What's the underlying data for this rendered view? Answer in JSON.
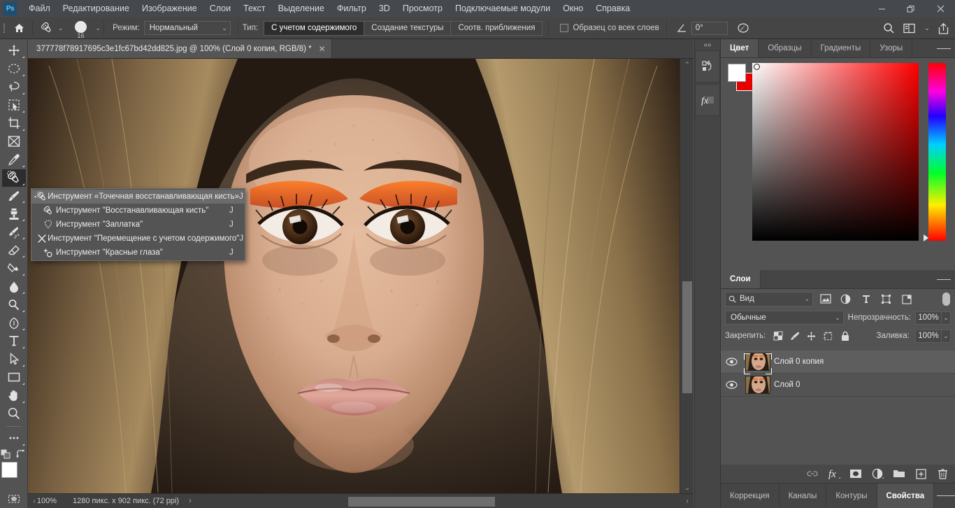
{
  "app": {
    "logo": "Ps",
    "menus": [
      "Файл",
      "Редактирование",
      "Изображение",
      "Слои",
      "Текст",
      "Выделение",
      "Фильтр",
      "3D",
      "Просмотр",
      "Подключаемые модули",
      "Окно",
      "Справка"
    ],
    "window_buttons": {
      "minimize": "—",
      "maximize": "❐",
      "close": "✕"
    }
  },
  "options_bar": {
    "home_icon": "home-icon",
    "brush_preset_icon": "spot-healing-brush-icon",
    "brush_size": "16",
    "mode_label": "Режим:",
    "mode_value": "Нормальный",
    "type_label": "Тип:",
    "type_options": [
      "С учетом содержимого",
      "Создание текстуры",
      "Соотв. приближения"
    ],
    "type_selected": "С учетом содержимого",
    "sample_all_layers_label": "Образец со всех слоев",
    "sample_all_layers_checked": false,
    "angle_icon": "angle-icon",
    "angle_value": "0°",
    "tablet_pressure_icon": "tablet-pressure-icon",
    "right_icons": [
      "search-icon",
      "workspace-icon",
      "chevron-down-icon",
      "share-icon"
    ]
  },
  "toolbar": {
    "tools": [
      {
        "name": "move-tool",
        "icon": "move-icon",
        "has_flyout": true
      },
      {
        "name": "elliptical-marquee-tool",
        "icon": "ellipse-marquee-icon",
        "has_flyout": true
      },
      {
        "name": "lasso-tool",
        "icon": "lasso-icon",
        "has_flyout": true
      },
      {
        "name": "object-selection-tool",
        "icon": "object-selection-icon",
        "has_flyout": true
      },
      {
        "name": "crop-tool",
        "icon": "crop-icon",
        "has_flyout": true
      },
      {
        "name": "frame-tool",
        "icon": "frame-icon",
        "has_flyout": false
      },
      {
        "name": "eyedropper-tool",
        "icon": "eyedropper-icon",
        "has_flyout": true
      },
      {
        "name": "spot-healing-brush-tool",
        "icon": "spot-healing-brush-icon",
        "has_flyout": true,
        "selected": true
      },
      {
        "name": "brush-tool",
        "icon": "brush-icon",
        "has_flyout": true
      },
      {
        "name": "clone-stamp-tool",
        "icon": "clone-stamp-icon",
        "has_flyout": true
      },
      {
        "name": "history-brush-tool",
        "icon": "history-brush-icon",
        "has_flyout": true
      },
      {
        "name": "eraser-tool",
        "icon": "eraser-icon",
        "has_flyout": true
      },
      {
        "name": "gradient-tool",
        "icon": "gradient-icon",
        "has_flyout": true
      },
      {
        "name": "blur-tool",
        "icon": "blur-drop-icon",
        "has_flyout": true
      },
      {
        "name": "dodge-tool",
        "icon": "dodge-icon",
        "has_flyout": true
      },
      {
        "name": "pen-tool",
        "icon": "pen-icon",
        "has_flyout": true
      },
      {
        "name": "horizontal-type-tool",
        "icon": "type-icon",
        "has_flyout": true
      },
      {
        "name": "path-selection-tool",
        "icon": "path-selection-icon",
        "has_flyout": true
      },
      {
        "name": "rectangle-tool",
        "icon": "rectangle-icon",
        "has_flyout": true
      },
      {
        "name": "hand-tool",
        "icon": "hand-icon",
        "has_flyout": true
      },
      {
        "name": "zoom-tool",
        "icon": "zoom-icon",
        "has_flyout": false
      },
      {
        "name": "edit-toolbar-tool",
        "icon": "ellipsis-icon",
        "has_flyout": true
      }
    ],
    "foreground_color": "#ffffff",
    "background_color": "#e60000",
    "default-colors-icon": "default-colors-icon",
    "swap-colors-icon": "swap-colors-icon",
    "quick-mask-icon": "quick-mask-icon"
  },
  "tool_flyout": {
    "items": [
      {
        "label": "Инструмент «Точечная восстанавливающая кисть»",
        "shortcut": "J",
        "icon": "spot-healing-brush-icon",
        "active": true
      },
      {
        "label": "Инструмент \"Восстанавливающая кисть\"",
        "shortcut": "J",
        "icon": "healing-brush-icon",
        "active": false
      },
      {
        "label": "Инструмент \"Заплатка\"",
        "shortcut": "J",
        "icon": "patch-icon",
        "active": false
      },
      {
        "label": "Инструмент \"Перемещение с учетом содержимого\"",
        "shortcut": "J",
        "icon": "content-aware-move-icon",
        "active": false
      },
      {
        "label": "Инструмент \"Красные глаза\"",
        "shortcut": "J",
        "icon": "red-eye-icon",
        "active": false
      }
    ]
  },
  "document": {
    "tab_title": "377778f78917695c3e1fc67bd42dd825.jpg @ 100% (Слой 0 копия, RGB/8) *",
    "close_glyph": "✕",
    "collapse_glyph": "««"
  },
  "status_bar": {
    "zoom": "100%",
    "dimensions": "1280 пикс. x 902 пикс. (72 ppi)",
    "next_glyph": "›",
    "prev_glyph": "‹"
  },
  "narrow_dock": {
    "collapse_glyph": "««",
    "buttons": [
      "history-icon",
      "fx-icon"
    ]
  },
  "color_panel": {
    "tabs": [
      "Цвет",
      "Образцы",
      "Градиенты",
      "Узоры"
    ],
    "active_tab": "Цвет",
    "foreground_color": "#ffffff",
    "background_color": "#e60000",
    "menu_icon": "panel-menu-icon"
  },
  "layers_panel": {
    "tabs": [
      "Слои"
    ],
    "active_tab": "Слои",
    "menu_icon": "panel-menu-icon",
    "filter_label": "Вид",
    "filter_icons": [
      "filter-pixels-icon",
      "filter-adjustment-icon",
      "filter-type-icon",
      "filter-shape-icon",
      "filter-smart-object-icon"
    ],
    "filter_toggle_on": true,
    "blend_mode": "Обычные",
    "opacity_label": "Непрозрачность:",
    "opacity_value": "100%",
    "lock_label": "Закрепить:",
    "lock_icons": [
      "lock-transparency-icon",
      "lock-image-icon",
      "lock-position-icon",
      "lock-artboard-icon",
      "lock-all-icon"
    ],
    "fill_label": "Заливка:",
    "fill_value": "100%",
    "layers": [
      {
        "name": "Слой 0 копия",
        "visible": true,
        "selected": true
      },
      {
        "name": "Слой 0",
        "visible": true,
        "selected": false
      }
    ],
    "action_icons": [
      "link-layers-icon",
      "fx-icon",
      "add-mask-icon",
      "adjustment-layer-icon",
      "new-group-icon",
      "new-layer-icon",
      "delete-layer-icon"
    ]
  },
  "bottom_panel_tabs": {
    "tabs": [
      "Коррекция",
      "Каналы",
      "Контуры",
      "Свойства"
    ],
    "active_tab": "Свойства",
    "menu_icon": "panel-menu-icon"
  }
}
